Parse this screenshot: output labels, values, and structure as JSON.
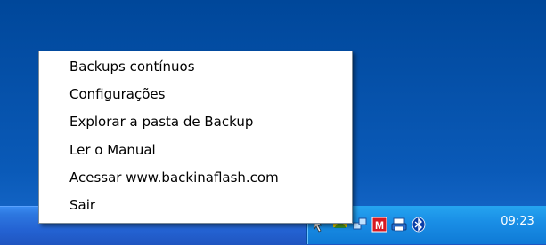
{
  "context_menu": {
    "items": [
      {
        "label": "Backups contínuos"
      },
      {
        "label": "Configurações"
      },
      {
        "label": "Explorar a pasta de Backup"
      },
      {
        "label": "Ler o Manual"
      },
      {
        "label": "Acessar www.backinaflash.com"
      },
      {
        "label": "Sair"
      }
    ]
  },
  "tray": {
    "clock": "09:23",
    "icons": [
      "backup-tray-icon",
      "network-icon",
      "mcafee-icon",
      "printer-icon",
      "bluetooth-icon"
    ]
  }
}
